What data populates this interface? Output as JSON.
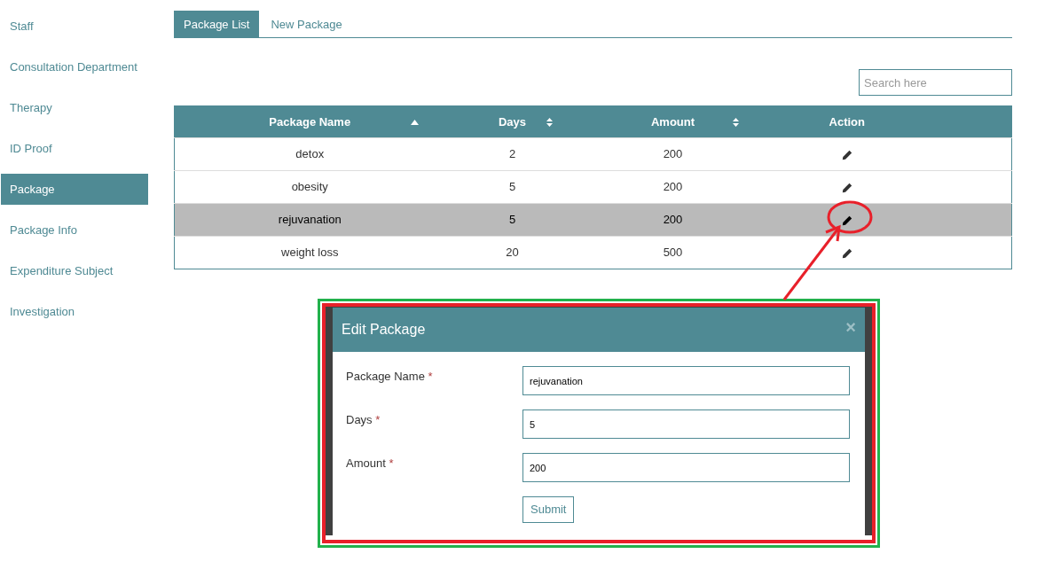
{
  "sidebar": {
    "items": [
      {
        "label": "Staff",
        "selected": false
      },
      {
        "label": "Consultation Department",
        "selected": false
      },
      {
        "label": "Therapy",
        "selected": false
      },
      {
        "label": "ID Proof",
        "selected": false
      },
      {
        "label": "Package",
        "selected": true
      },
      {
        "label": "Package Info",
        "selected": false
      },
      {
        "label": "Expenditure Subject",
        "selected": false
      },
      {
        "label": "Investigation",
        "selected": false
      }
    ]
  },
  "tabs": [
    {
      "label": "Package List",
      "selected": true
    },
    {
      "label": "New Package",
      "selected": false
    }
  ],
  "search": {
    "placeholder": "Search here"
  },
  "table": {
    "columns": [
      {
        "label": "Package Name",
        "sortable": true,
        "sorted": true
      },
      {
        "label": "Days",
        "sortable": true,
        "sorted": false
      },
      {
        "label": "Amount",
        "sortable": true,
        "sorted": false
      },
      {
        "label": "Action",
        "sortable": false,
        "sorted": false
      }
    ],
    "rows": [
      {
        "cells": [
          "detox",
          "2",
          "200"
        ],
        "selected": false
      },
      {
        "cells": [
          "obesity",
          "5",
          "200"
        ],
        "selected": false
      },
      {
        "cells": [
          "rejuvanation",
          "5",
          "200"
        ],
        "selected": true
      },
      {
        "cells": [
          "weight loss",
          "20",
          "500"
        ],
        "selected": false
      }
    ]
  },
  "modal": {
    "title": "Edit Package",
    "close": "×",
    "fields": [
      {
        "label": "Package Name",
        "required_mark": "*",
        "value": "rejuvanation"
      },
      {
        "label": "Days",
        "required_mark": "*",
        "value": "5"
      },
      {
        "label": "Amount",
        "required_mark": "*",
        "value": "200"
      }
    ],
    "submit": "Submit"
  }
}
